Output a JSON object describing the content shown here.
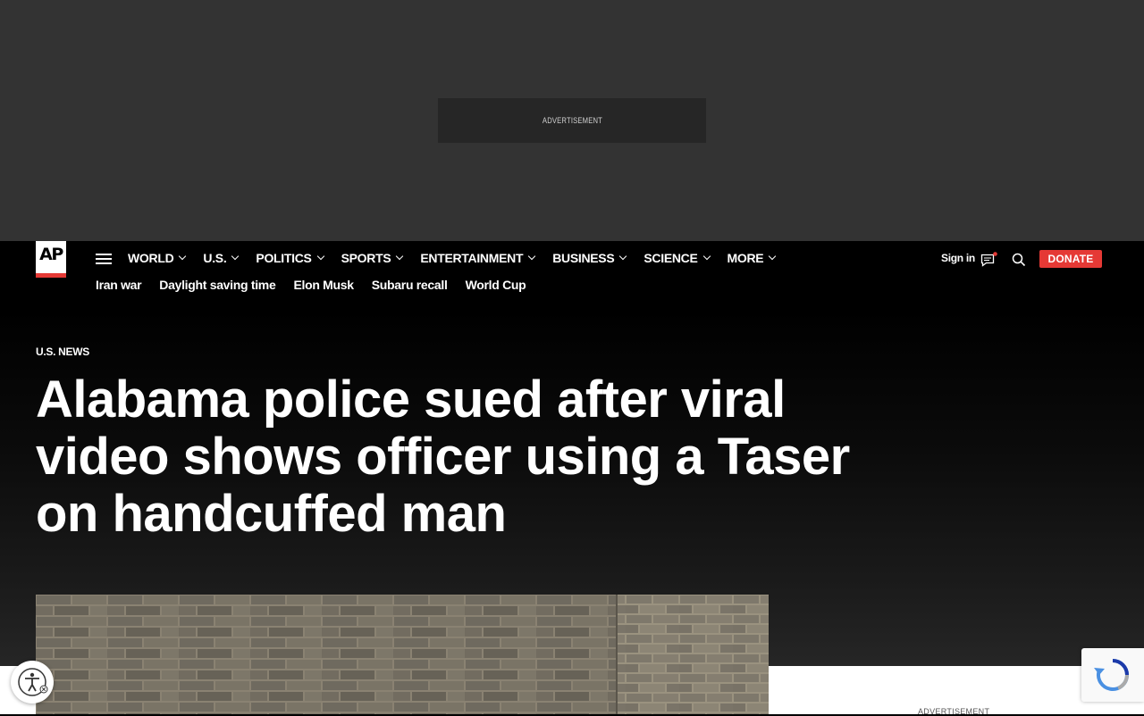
{
  "ad_top": {
    "label": "ADVERTISEMENT"
  },
  "header": {
    "logo": "AP",
    "nav": [
      {
        "label": "WORLD"
      },
      {
        "label": "U.S."
      },
      {
        "label": "POLITICS"
      },
      {
        "label": "SPORTS"
      },
      {
        "label": "ENTERTAINMENT"
      },
      {
        "label": "BUSINESS"
      },
      {
        "label": "SCIENCE"
      },
      {
        "label": "MORE"
      }
    ],
    "trending": [
      "Iran war",
      "Daylight saving time",
      "Elon Musk",
      "Subaru recall",
      "World Cup"
    ],
    "signin": "Sign in",
    "donate": "DONATE",
    "icons": [
      "menu-icon",
      "chat-icon",
      "search-icon"
    ],
    "accent_color": "#e53935"
  },
  "article": {
    "section": "U.S. NEWS",
    "headline": "Alabama police sued after viral video shows officer using a Taser on handcuffed man"
  },
  "sidebar": {
    "ad_label": "ADVERTISEMENT"
  },
  "widgets": {
    "accessibility": "accessibility-icon",
    "recaptcha": "recaptcha-icon"
  }
}
